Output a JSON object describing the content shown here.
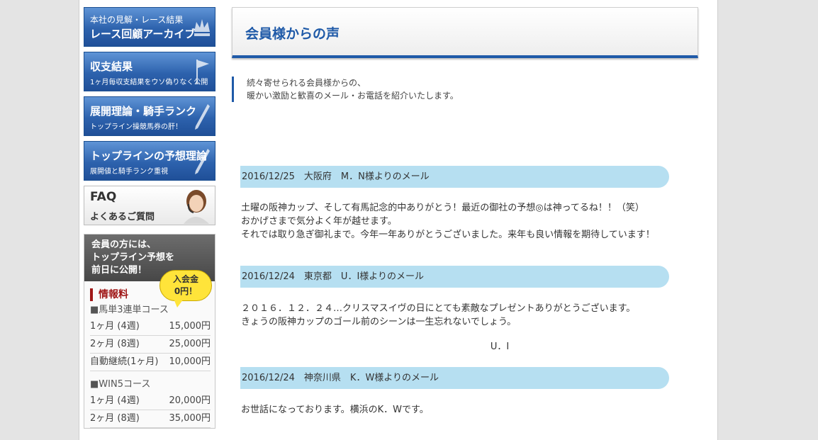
{
  "sidebar": {
    "banners": [
      {
        "line1": "本社の見解・レース結果",
        "line2": "レース回顧アーカイブ",
        "icon": "crown-icon"
      },
      {
        "line1": "収支結果",
        "line2": "1ヶ月毎収支結果をウソ偽りなく公開",
        "icon": "flag-icon"
      },
      {
        "line1": "展開理論・騎手ランク",
        "line2": "トップライン操競馬券の肝！",
        "icon": "pencil-icon"
      },
      {
        "line1": "トップラインの予想理論",
        "line2": "展開値と騎手ランク重視",
        "icon": "pencil-icon"
      },
      {
        "line1": "FAQ",
        "line2": "よくあるご質問",
        "icon": "operator-icon"
      }
    ],
    "fee_box": {
      "head_lines": [
        "会員の方には、",
        "トップライン予想を",
        "前日に公開！"
      ],
      "bubble_lines": [
        "入会金",
        "0円！"
      ],
      "title": "情報料",
      "courses": [
        {
          "name": "■馬単3連単コース",
          "rows": [
            {
              "label": "1ヶ月 (4週)",
              "price": "15,000円"
            },
            {
              "label": "2ヶ月 (8週)",
              "price": "25,000円"
            },
            {
              "label": "自動継続(1ヶ月)",
              "price": "10,000円"
            }
          ]
        },
        {
          "name": "■WIN5コース",
          "rows": [
            {
              "label": "1ヶ月 (4週)",
              "price": "20,000円"
            },
            {
              "label": "2ヶ月 (8週)",
              "price": "35,000円"
            }
          ]
        }
      ]
    }
  },
  "main": {
    "title": "会員様からの声",
    "intro": [
      "続々寄せられる会員様からの、",
      "暖かい激励と歓喜のメール・お電話を紹介いたします。"
    ],
    "messages": [
      {
        "header": "2016/12/25　大阪府　M．N様よりのメール",
        "lines": [
          "土曜の阪神カップ、そして有馬記念的中ありがとう！最近の御社の予想◎は神ってるね！！（笑）",
          "おかげさまで気分よく年が越せます。",
          "それでは取り急ぎ御礼まで。今年一年ありがとうございました。来年も良い情報を期待しています！"
        ]
      },
      {
        "header": "2016/12/24　東京都　U．I様よりのメール",
        "lines": [
          "２０１６．１２．２４…クリスマスイヴの日にとても素敵なプレゼントありがとうございます。",
          "きょうの阪神カップのゴール前のシーンは一生忘れないでしょう。"
        ],
        "sign": "U．I"
      },
      {
        "header": "2016/12/24　神奈川県　K．W様よりのメール",
        "lines": [
          "お世話になっております。横浜のK．Wです。"
        ]
      }
    ]
  }
}
